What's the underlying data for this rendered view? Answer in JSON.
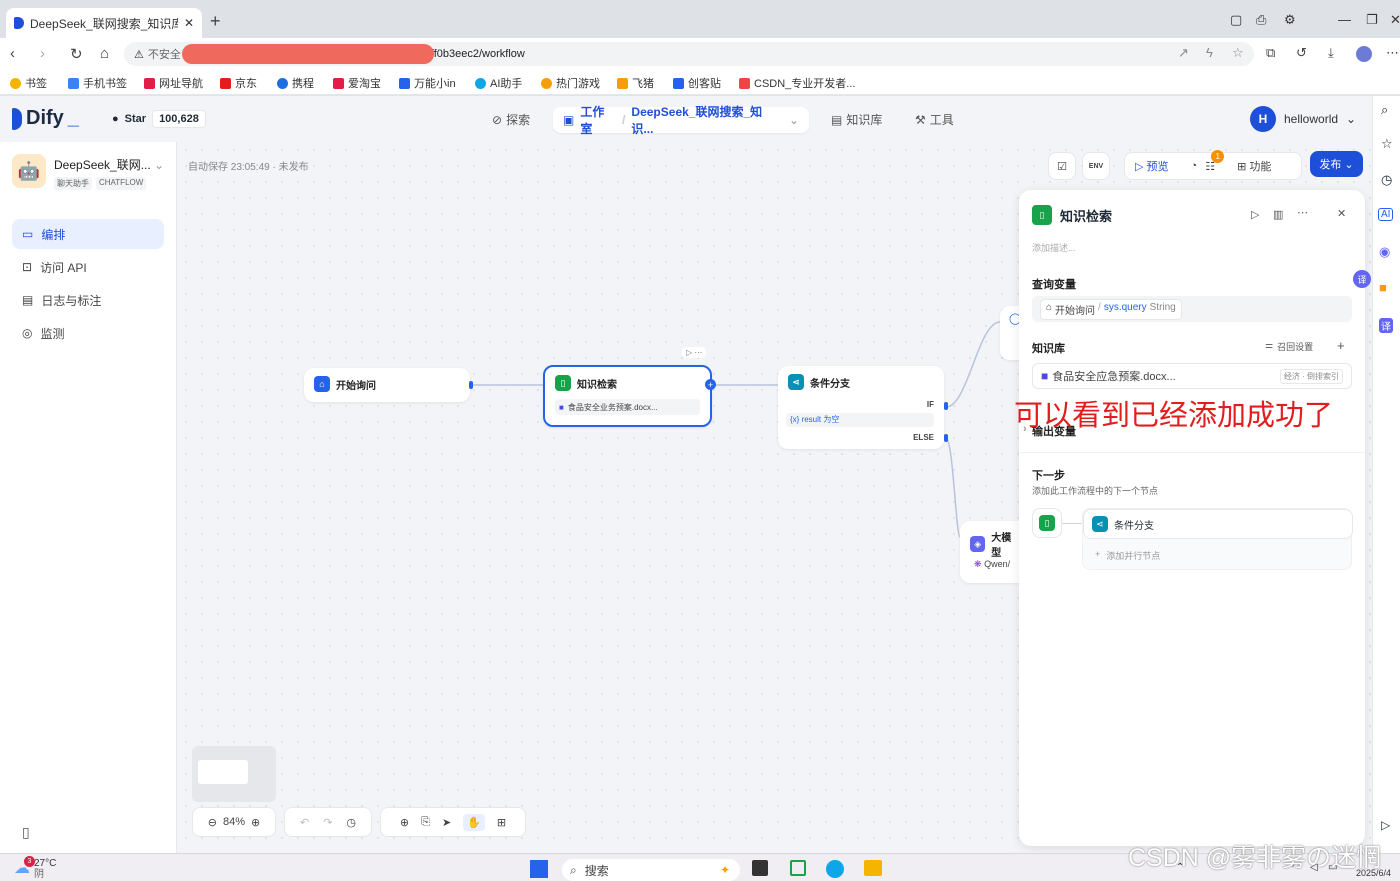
{
  "browser": {
    "tab_title": "DeepSeek_联网搜索_知识库 - Di",
    "url_warning": "不安全",
    "url_tail": "ff0b3eec2/workflow",
    "bookmarks": [
      "书签",
      "手机书签",
      "网址导航",
      "京东",
      "携程",
      "爱淘宝",
      "万能小in",
      "AI助手",
      "热门游戏",
      "飞猪",
      "创客贴",
      "CSDN_专业开发者..."
    ]
  },
  "topnav": {
    "logo": "Dify",
    "star_label": "Star",
    "star_count": "100,628",
    "explore": "探索",
    "studio": "工作室",
    "current_app": "DeepSeek_联网搜索_知识...",
    "knowledge": "知识库",
    "tools": "工具",
    "user_initial": "H",
    "user_name": "helloworld"
  },
  "sidebar": {
    "app_name": "DeepSeek_联网...",
    "tag1": "聊天助手",
    "tag2": "CHATFLOW",
    "items": [
      {
        "label": "编排"
      },
      {
        "label": "访问 API"
      },
      {
        "label": "日志与标注"
      },
      {
        "label": "监测"
      }
    ]
  },
  "canvas": {
    "autosave": "自动保存 23:05:49 · 未发布",
    "toolbar": {
      "preview": "预览",
      "features": "功能",
      "publish": "发布",
      "badge": "1",
      "env": "ENV"
    },
    "zoom": "84%",
    "nodes": {
      "start": "开始询问",
      "knowledge": "知识检索",
      "knowledge_file": "食品安全业务预案.docx...",
      "branch": "条件分支",
      "branch_if": "IF",
      "branch_result": "{x}  result 为空",
      "branch_else": "ELSE",
      "llm": "大模型",
      "llm_model": "Qwen/"
    }
  },
  "panel": {
    "title": "知识检索",
    "desc_placeholder": "添加描述...",
    "query_label": "查询变量",
    "query_value_a": "开始询问",
    "query_sep": "/",
    "query_value_b": "sys.query",
    "query_type": "String",
    "kb_label": "知识库",
    "recall": "召回设置",
    "kb_file": "食品安全应急预案.docx...",
    "kb_tag": "经济 · 倒排索引",
    "output_label": "输出变量",
    "next_label": "下一步",
    "next_desc": "添加此工作流程中的下一个节点",
    "next_node": "条件分支",
    "add_parallel": "添加并行节点"
  },
  "annotation": "可以看到已经添加成功了",
  "watermark": "CSDN @雾非雾の迷惘",
  "taskbar": {
    "weather": "27°C",
    "weather_sub": "阴",
    "weather_badge": "3",
    "search": "搜索",
    "date": "2025/6/4"
  }
}
